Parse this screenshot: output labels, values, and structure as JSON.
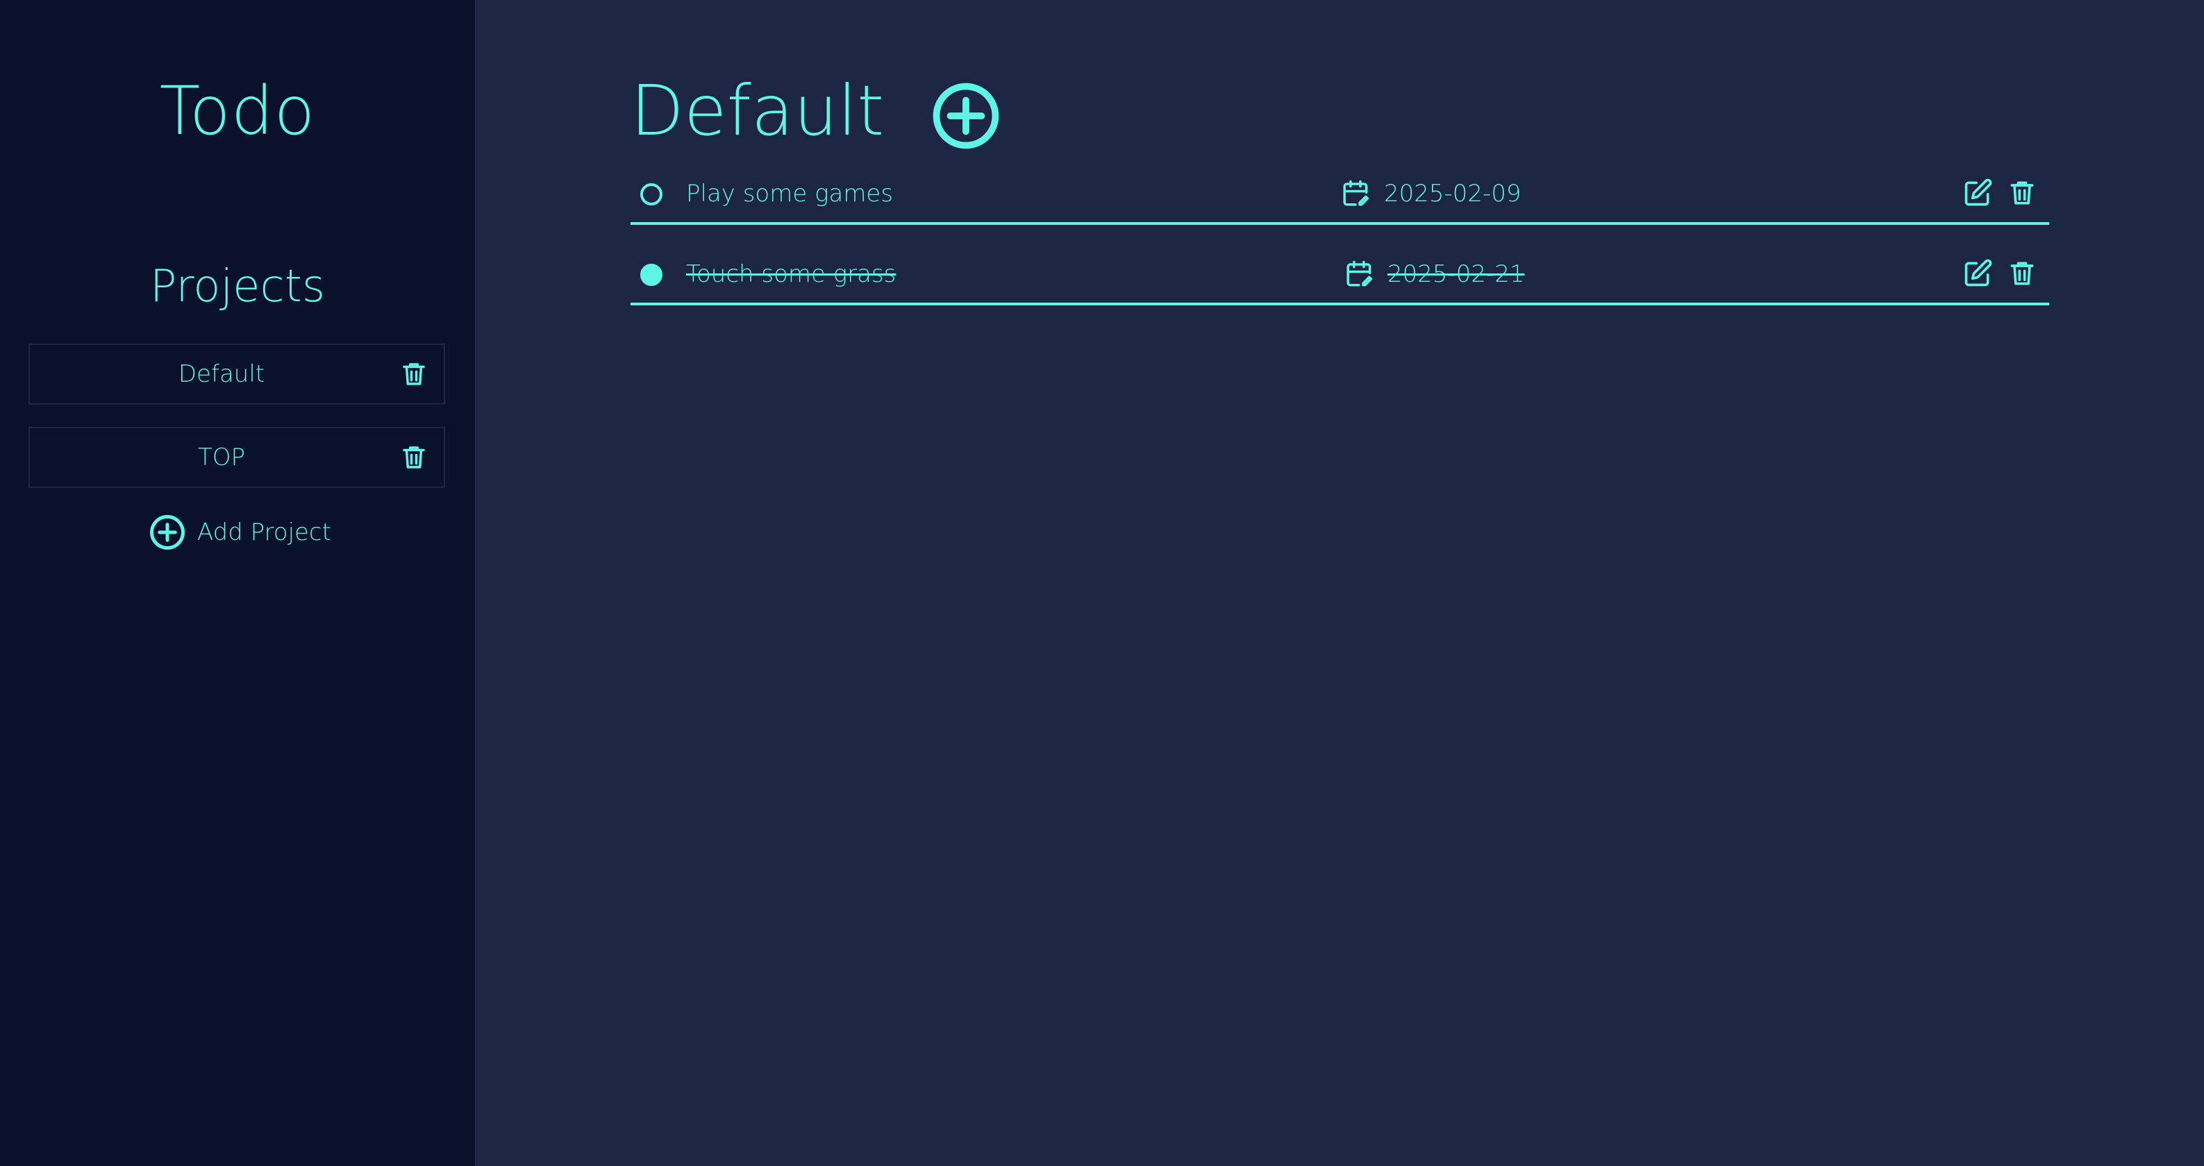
{
  "app": {
    "title": "Todo",
    "accent_color": "#5ff5e6",
    "sidebar_bg": "#0a112b",
    "main_bg": "#1c2541"
  },
  "sidebar": {
    "projects_heading": "Projects",
    "projects": [
      {
        "label": "Default",
        "delete_icon": "trash-icon"
      },
      {
        "label": "TOP",
        "delete_icon": "trash-icon"
      }
    ],
    "add_project_label": "Add Project",
    "add_project_icon": "plus-circle-icon"
  },
  "main": {
    "title": "Default",
    "add_todo_icon": "plus-circle-icon",
    "todos": [
      {
        "title": "Play some games",
        "due_date": "2025-02-09",
        "completed": false,
        "date_icon": "calendar-edit-icon",
        "edit_icon": "edit-icon",
        "delete_icon": "trash-icon"
      },
      {
        "title": "Touch some grass",
        "due_date": "2025-02-21",
        "completed": true,
        "date_icon": "calendar-edit-icon",
        "edit_icon": "edit-icon",
        "delete_icon": "trash-icon"
      }
    ]
  }
}
